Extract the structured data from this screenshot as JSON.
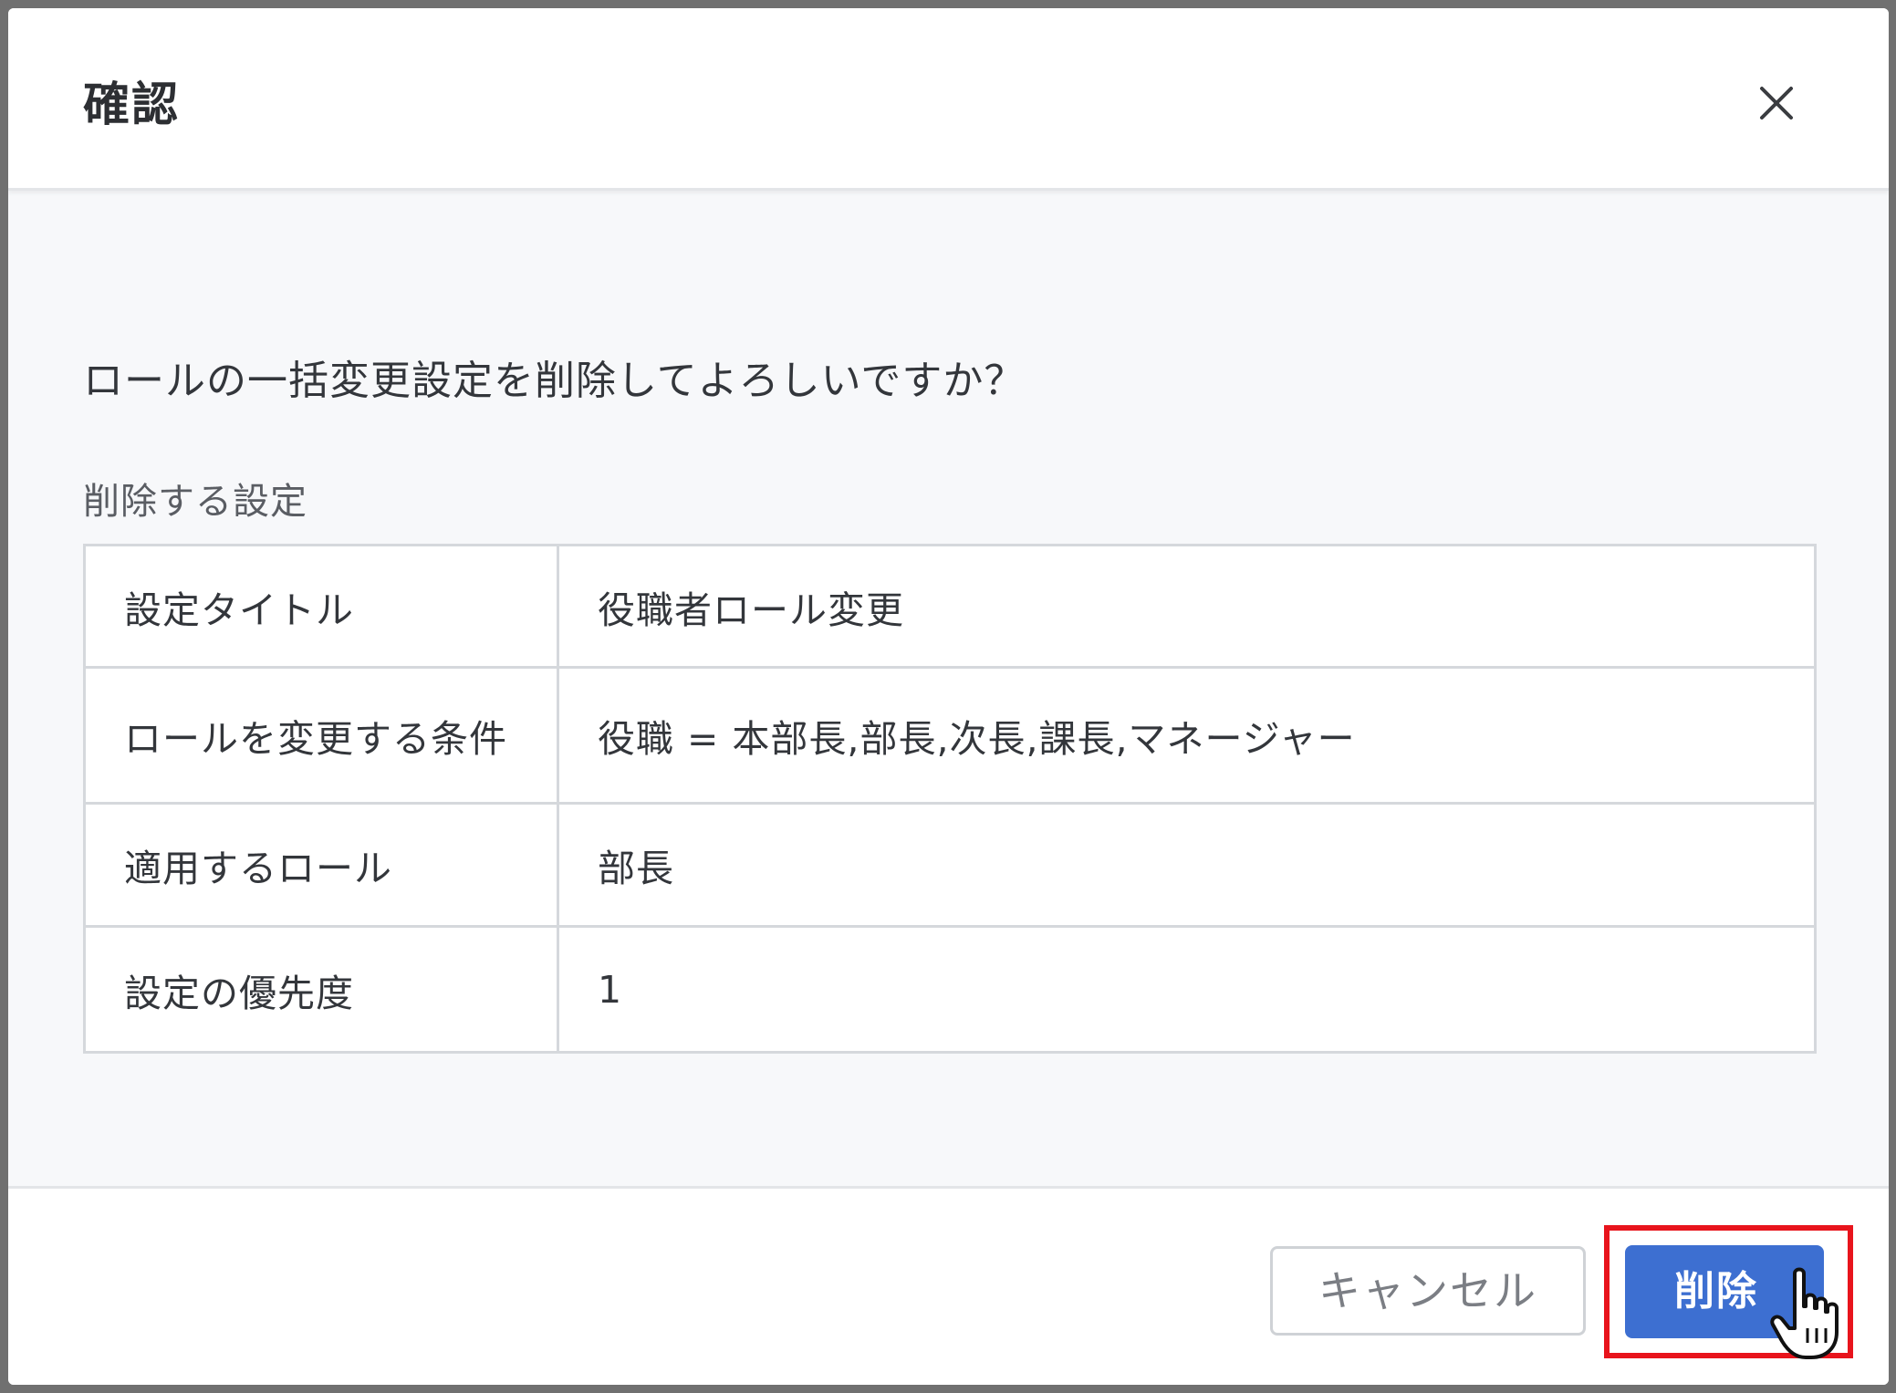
{
  "dialog": {
    "title": "確認",
    "close_icon": "close-icon",
    "message": "ロールの一括変更設定を削除してよろしいですか？",
    "section_label": "削除する設定",
    "settings": [
      {
        "key": "設定タイトル",
        "value": "役職者ロール変更"
      },
      {
        "key": "ロールを変更する条件",
        "value": "役職 = 本部長,部長,次長,課長,マネージャー"
      },
      {
        "key": "適用するロール",
        "value": "部長"
      },
      {
        "key": "設定の優先度",
        "value": "1"
      }
    ],
    "footer": {
      "cancel_label": "キャンセル",
      "delete_label": "削除"
    }
  },
  "colors": {
    "primary": "#3d6fd1",
    "highlight": "#e8141c"
  },
  "cursor_icon": "hand-pointer-icon"
}
